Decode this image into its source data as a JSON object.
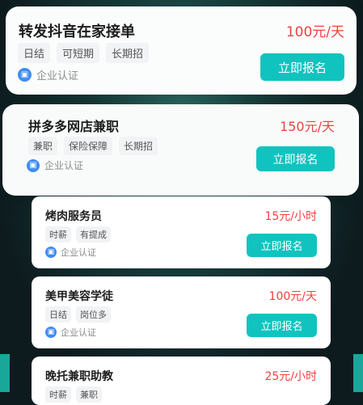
{
  "jobs": [
    {
      "title": "转发抖音在家接单",
      "salary": "100元/天",
      "tags": [
        "日结",
        "可短期",
        "长期招"
      ],
      "cert": "企业认证",
      "apply": "立即报名"
    },
    {
      "title": "拼多多网店兼职",
      "salary": "150元/天",
      "tags": [
        "兼职",
        "保险保障",
        "长期招"
      ],
      "cert": "企业认证",
      "apply": "立即报名"
    },
    {
      "title": "烤肉服务员",
      "salary": "15元/小时",
      "tags": [
        "时薪",
        "有提成"
      ],
      "cert": "企业认证",
      "apply": "立即报名"
    },
    {
      "title": "美甲美容学徒",
      "salary": "100元/天",
      "tags": [
        "日结",
        "岗位多"
      ],
      "cert": "企业认证",
      "apply": "立即报名"
    },
    {
      "title": "晚托兼职助教",
      "salary": "25元/小时",
      "tags": [
        "时薪",
        "兼职"
      ]
    }
  ],
  "icons": {
    "cert": "verified-company-icon"
  },
  "colors": {
    "accent": "#11c3bf",
    "salary": "#f04141",
    "cert": "#3d8df5"
  }
}
